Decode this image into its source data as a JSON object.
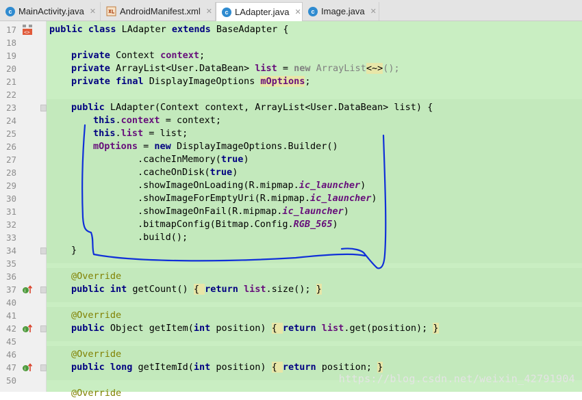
{
  "tabs": [
    {
      "label": "MainActivity.java",
      "icon": "java-class-icon",
      "active": false
    },
    {
      "label": "AndroidManifest.xml",
      "icon": "xml-file-icon",
      "active": false
    },
    {
      "label": "LAdapter.java",
      "icon": "java-class-icon",
      "active": true
    },
    {
      "label": "Image.java",
      "icon": "java-class-icon",
      "active": false
    }
  ],
  "close_glyph": "✕",
  "lines": [
    {
      "n": "17"
    },
    {
      "n": "18"
    },
    {
      "n": "19"
    },
    {
      "n": "20"
    },
    {
      "n": "21"
    },
    {
      "n": "22"
    },
    {
      "n": "23"
    },
    {
      "n": "24"
    },
    {
      "n": "25"
    },
    {
      "n": "26"
    },
    {
      "n": "27"
    },
    {
      "n": "28"
    },
    {
      "n": "29"
    },
    {
      "n": "30"
    },
    {
      "n": "31"
    },
    {
      "n": "32"
    },
    {
      "n": "33"
    },
    {
      "n": "34"
    },
    {
      "n": "35"
    },
    {
      "n": "36"
    },
    {
      "n": "37"
    },
    {
      "n": "40"
    },
    {
      "n": "41"
    },
    {
      "n": "42"
    },
    {
      "n": "45"
    },
    {
      "n": "46"
    },
    {
      "n": "47"
    },
    {
      "n": "50"
    }
  ],
  "code": {
    "l17": {
      "a": "public class ",
      "b": "LAdapter ",
      "c": "extends ",
      "d": "BaseAdapter {"
    },
    "l19": {
      "a": "private ",
      "b": "Context ",
      "c": "context",
      "d": ";"
    },
    "l20": {
      "a": "private ",
      "b": "ArrayList<User.DataBean> ",
      "c": "list",
      "d": " = ",
      "e": "new ",
      "f": "ArrayList",
      "g": "<~>",
      "h": "();"
    },
    "l21": {
      "a": "private final ",
      "b": "DisplayImageOptions ",
      "c": "mOptions",
      "d": ";"
    },
    "l23": {
      "a": "public ",
      "b": "LAdapter(Context context, ArrayList<User.DataBean> list) {"
    },
    "l24": {
      "a": "this",
      "b": ".",
      "c": "context",
      "d": " = context;"
    },
    "l25": {
      "a": "this",
      "b": ".",
      "c": "list",
      "d": " = list;"
    },
    "l26": {
      "a": "mOptions",
      "b": " = ",
      "c": "new ",
      "d": "DisplayImageOptions.Builder()"
    },
    "l27": {
      "a": ".cacheInMemory(",
      "b": "true",
      "c": ")"
    },
    "l28": {
      "a": ".cacheOnDisk(",
      "b": "true",
      "c": ")"
    },
    "l29": {
      "a": ".showImageOnLoading(R.mipmap.",
      "b": "ic_launcher",
      "c": ")"
    },
    "l30": {
      "a": ".showImageForEmptyUri(R.mipmap.",
      "b": "ic_launcher",
      "c": ")"
    },
    "l31": {
      "a": ".showImageOnFail(R.mipmap.",
      "b": "ic_launcher",
      "c": ")"
    },
    "l32": {
      "a": ".bitmapConfig(Bitmap.Config.",
      "b": "RGB_565",
      "c": ")"
    },
    "l33": {
      "a": ".build();"
    },
    "l34": {
      "a": "}"
    },
    "l36": {
      "a": "@Override"
    },
    "l37": {
      "a": "public int ",
      "b": "getCount() ",
      "c": "{ ",
      "d": "return ",
      "e": "list",
      "f": ".size(); ",
      "g": "}"
    },
    "l41": {
      "a": "@Override"
    },
    "l42": {
      "a": "public ",
      "b": "Object getItem(",
      "c": "int ",
      "d": "position) ",
      "e": "{ ",
      "f": "return ",
      "g": "list",
      "h": ".get(position); ",
      "i": "}"
    },
    "l46": {
      "a": "@Override"
    },
    "l47": {
      "a": "public long ",
      "b": "getItemId(",
      "c": "int ",
      "d": "position) ",
      "e": "{ ",
      "f": "return ",
      "g": "position; ",
      "h": "}"
    },
    "l50b": {
      "a": "@Override"
    }
  },
  "watermark": "https://blog.csdn.net/weixin_42791904",
  "colors": {
    "code_bg": "#c9eec2",
    "keyword": "#000080",
    "field": "#660e7a",
    "annotation": "#808000",
    "pen": "#1030d8"
  }
}
